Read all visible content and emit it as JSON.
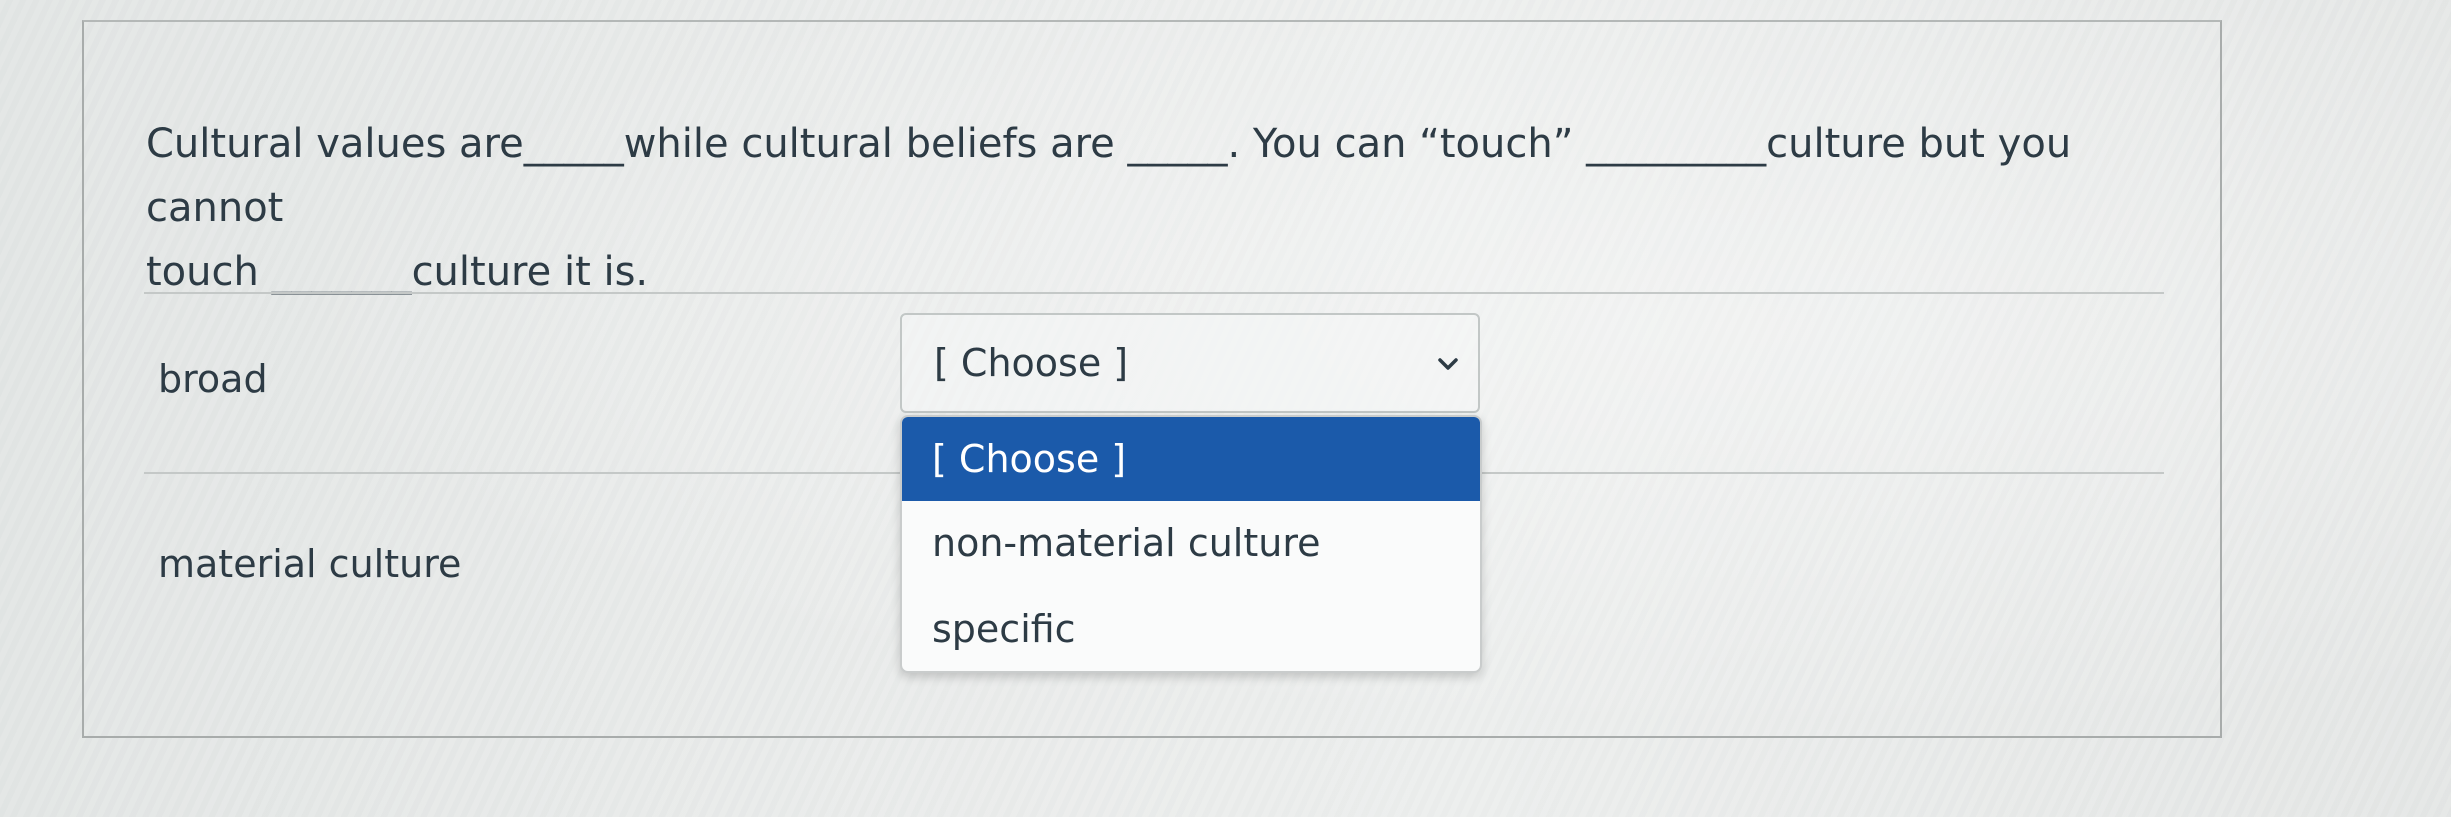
{
  "question": {
    "line1": "Cultural values are_____while cultural beliefs are _____. You can “touch” _________culture but you cannot",
    "line2": "touch _______culture it is."
  },
  "answers": [
    {
      "label": "broad",
      "select_value": "[ Choose ]"
    },
    {
      "label": "material culture"
    }
  ],
  "dropdown": {
    "options": [
      "[ Choose ]",
      "non-material culture",
      "specific"
    ],
    "selected_index": 0
  },
  "colors": {
    "highlight": "#1b5aaa",
    "text": "#2d3b45"
  },
  "icons": {
    "select_toggle": "chevron-down-icon"
  }
}
